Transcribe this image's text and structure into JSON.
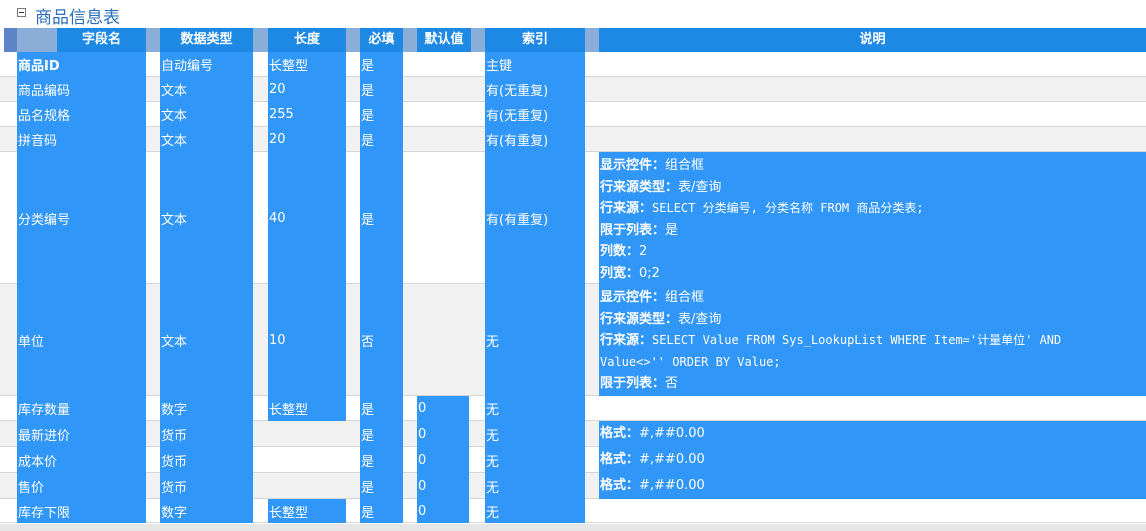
{
  "page": {
    "title": "商品信息表"
  },
  "columns": [
    "字段名",
    "数据类型",
    "长度",
    "必填",
    "默认值",
    "索引",
    "说明"
  ],
  "rows": [
    {
      "name": "商品ID",
      "type": "自动编号",
      "length": "长整型",
      "required": "是",
      "default": "",
      "index": "主键",
      "desc": []
    },
    {
      "name": "商品编码",
      "type": "文本",
      "length": "20",
      "required": "是",
      "default": "",
      "index": "有(无重复)",
      "desc": []
    },
    {
      "name": "品名规格",
      "type": "文本",
      "length": "255",
      "required": "是",
      "default": "",
      "index": "有(无重复)",
      "desc": []
    },
    {
      "name": "拼音码",
      "type": "文本",
      "length": "20",
      "required": "是",
      "default": "",
      "index": "有(有重复)",
      "desc": []
    },
    {
      "name": "分类编号",
      "type": "文本",
      "length": "40",
      "required": "是",
      "default": "",
      "index": "有(有重复)",
      "desc": [
        {
          "key": "显示控件：",
          "val": "组合框"
        },
        {
          "key": "行来源类型：",
          "val": "表/查询"
        },
        {
          "key": "行来源：",
          "val": "SELECT 分类编号, 分类名称 FROM 商品分类表;",
          "mono": true
        },
        {
          "key": "限于列表：",
          "val": "是"
        },
        {
          "key": "列数：",
          "val": "2"
        },
        {
          "key": "列宽：",
          "val": "0;2"
        }
      ]
    },
    {
      "name": "单位",
      "type": "文本",
      "length": "10",
      "required": "否",
      "default": "",
      "index": "无",
      "desc": [
        {
          "key": "显示控件：",
          "val": "组合框"
        },
        {
          "key": "行来源类型：",
          "val": "表/查询"
        },
        {
          "key": "行来源：",
          "val": "SELECT Value FROM Sys_LookupList WHERE Item='计量单位' AND",
          "mono": true
        },
        {
          "key": "",
          "val": "Value<>'' ORDER BY Value;",
          "mono": true
        },
        {
          "key": "限于列表：",
          "val": "否"
        }
      ]
    },
    {
      "name": "库存数量",
      "type": "数字",
      "length": "长整型",
      "required": "是",
      "default": "0",
      "index": "无",
      "desc": []
    },
    {
      "name": "最新进价",
      "type": "货币",
      "length": "",
      "required": "是",
      "default": "0",
      "index": "无",
      "desc": [
        {
          "key": "格式：",
          "val": "#,##0.00"
        }
      ]
    },
    {
      "name": "成本价",
      "type": "货币",
      "length": "",
      "required": "是",
      "default": "0",
      "index": "无",
      "desc": [
        {
          "key": "格式：",
          "val": "#,##0.00"
        }
      ]
    },
    {
      "name": "售价",
      "type": "货币",
      "length": "",
      "required": "是",
      "default": "0",
      "index": "无",
      "desc": [
        {
          "key": "格式：",
          "val": "#,##0.00"
        }
      ]
    },
    {
      "name": "库存下限",
      "type": "数字",
      "length": "长整型",
      "required": "是",
      "default": "0",
      "index": "无",
      "desc": []
    }
  ]
}
